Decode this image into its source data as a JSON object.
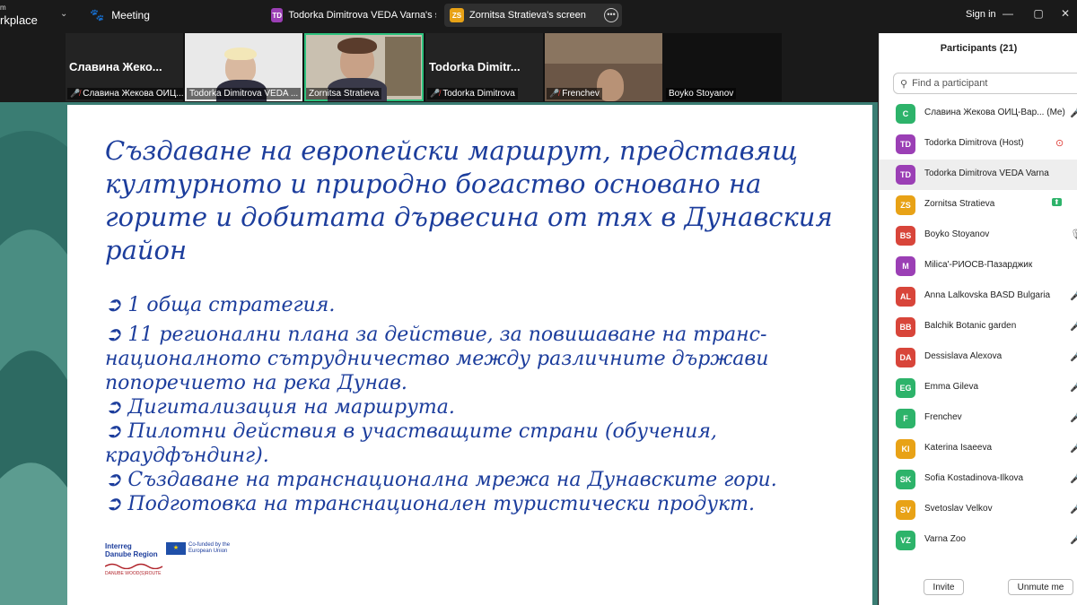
{
  "topbar": {
    "brand_small": "m",
    "brand_name": "rkplace",
    "meeting_label": "Meeting",
    "tabs": [
      {
        "badge": "TD",
        "badge_color": "#9b3fb5",
        "label": "Todorka Dimitrova VEDA Varna's screen"
      },
      {
        "badge": "ZS",
        "badge_color": "#e8a216",
        "label": "Zornitsa Stratieva's screen"
      }
    ],
    "sign_in": "Sign in"
  },
  "video_strip": [
    {
      "type": "name",
      "name": "Славина Жеко...",
      "label": "Славина Жекова ОИЦ...",
      "muted": true
    },
    {
      "type": "video",
      "label": "Todorka Dimitrova VEDA ...",
      "muted": false
    },
    {
      "type": "video",
      "label": "Zornitsa Stratieva",
      "muted": false,
      "active": true
    },
    {
      "type": "name",
      "name": "Todorka Dimitr...",
      "label": "Todorka Dimitrova",
      "muted": true
    },
    {
      "type": "video",
      "label": "Frenchev",
      "muted": true
    },
    {
      "type": "name",
      "name": "",
      "label": "Boyko Stoyanov",
      "muted": false
    }
  ],
  "slide": {
    "title": "Създаване на европейски маршрут, представящ културното и природно богаство основано на горите и добитата дървесина от тях в Дунавския район",
    "bullets": [
      "➲ 1 обща стратегия.",
      "➲ 11 регионални плана за действие, за повишаване на транс-националното сътрудничество между различните държави попоречието на река  Дунав.",
      "➲ Дигитализация на маршрута.",
      "➲ Пилотни действия в участващите страни (обучения, краудфъндинг).",
      "➲ Създаване на транснационална мрежа на Дунавските гори.",
      "➲ Подготовка на транснационален туристически продукт."
    ],
    "logo_interreg": "Interreg",
    "logo_region": "Danube Region",
    "logo_eu": "Co-funded by the European Union",
    "logo_dw": "DANUBE WOOD(S)ROUTE"
  },
  "participants": {
    "title": "Participants (21)",
    "search_placeholder": "Find a participant",
    "items": [
      {
        "initials": "C",
        "color": "#2db36a",
        "name": "Славина Жекова ОИЦ-Вар... (Me)",
        "icon": "muted"
      },
      {
        "initials": "TD",
        "color": "#9b3fb5",
        "name": "Todorka Dimitrova (Host)",
        "icon": "recording"
      },
      {
        "initials": "TD",
        "color": "#9b3fb5",
        "name": "Todorka Dimitrova VEDA Varna",
        "icon": "",
        "highlight": true
      },
      {
        "initials": "ZS",
        "color": "#e8a216",
        "name": "Zornitsa Stratieva",
        "icon": "sharing"
      },
      {
        "initials": "BS",
        "color": "#d8453a",
        "name": "Boyko Stoyanov",
        "icon": "mic"
      },
      {
        "initials": "M",
        "color": "#9b3fb5",
        "name": "Milica'-РИОСВ-Пазарджик",
        "icon": ""
      },
      {
        "initials": "AL",
        "color": "#d8453a",
        "name": "Anna Lalkovska  BASD Bulgaria",
        "icon": "muted"
      },
      {
        "initials": "BB",
        "color": "#d8453a",
        "name": "Balchik Botanic garden",
        "icon": "muted"
      },
      {
        "initials": "DA",
        "color": "#d8453a",
        "name": "Dessislava Alexova",
        "icon": "muted"
      },
      {
        "initials": "EG",
        "color": "#2db36a",
        "name": "Emma Gileva",
        "icon": "muted"
      },
      {
        "initials": "F",
        "color": "#2db36a",
        "name": "Frenchev",
        "icon": "muted"
      },
      {
        "initials": "KI",
        "color": "#e8a216",
        "name": "Katerina Isaeeva",
        "icon": "muted"
      },
      {
        "initials": "SK",
        "color": "#2db36a",
        "name": "Sofia Kostadinova-Ilkova",
        "icon": "muted"
      },
      {
        "initials": "SV",
        "color": "#e8a216",
        "name": "Svetoslav Velkov",
        "icon": "muted"
      },
      {
        "initials": "VZ",
        "color": "#2db36a",
        "name": "Varna Zoo",
        "icon": "muted"
      }
    ],
    "invite_label": "Invite",
    "unmute_label": "Unmute me"
  }
}
